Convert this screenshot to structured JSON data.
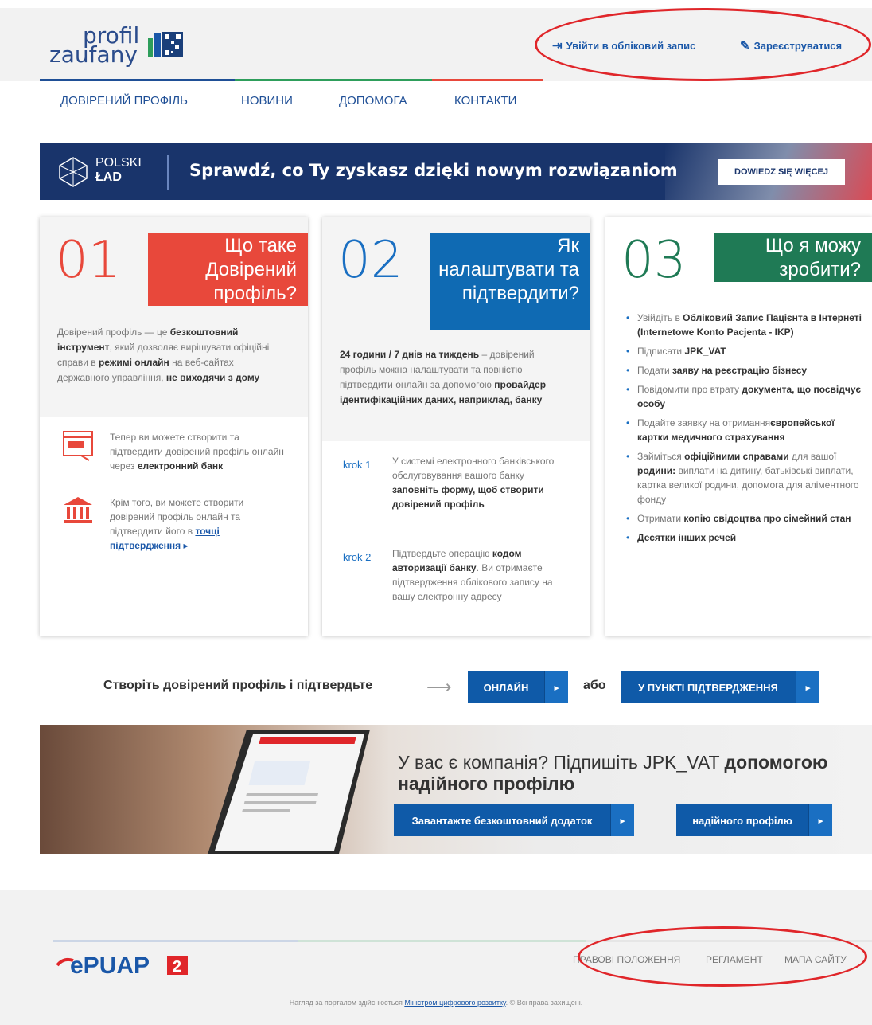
{
  "header": {
    "logo_line1": "profil",
    "logo_line2": "zaufany",
    "login": "Увійти в обліковий запис",
    "register": "Зареєструватися"
  },
  "colors": {
    "blue": "#1f4f96",
    "red": "#e8483b",
    "green": "#1f7a55",
    "navy": "#19346b"
  },
  "nav": [
    "ДОВІРЕНИЙ ПРОФІЛЬ",
    "НОВИНИ",
    "ДОПОМОГА",
    "КОНТАКТИ"
  ],
  "banner": {
    "logo_top": "POLSKI",
    "logo_bottom": "ŁAD",
    "text": "Sprawdź, co Ty zyskasz dzięki nowym rozwiązaniom",
    "button": "DOWIEDZ SIĘ WIĘCEJ"
  },
  "card1": {
    "num": "01",
    "title": "Що таке Довірений профіль?",
    "p": "Довірений профіль — це ",
    "p_b1": "безкоштовний інструмент",
    "p2": ", який дозволяє вирішувати офіційні справи в ",
    "p_b2": "режимі онлайн",
    "p3": " на веб-сайтах державного управління, ",
    "p_b3": "не виходячи з дому",
    "r1": "Тепер ви можете створити та підтвердити довірений профіль онлайн через ",
    "r1_b": "електронний банк",
    "r2": "Крім того, ви можете створити довірений профіль онлайн та підтвердити його в ",
    "r2_link": "точці підтвердження",
    "r2_arrow": "▸"
  },
  "card2": {
    "num": "02",
    "title": "Як налаштувати та підтвердити?",
    "p_b": "24 години / 7 днів на тиждень",
    "p": " – довірений профіль можна налаштувати та повністю підтвердити онлайн за допомогою ",
    "p_b2": "провайдер ідентифікаційних даних, наприклад, банку",
    "k1": "krok 1",
    "k1_t": "У системі електронного банківського обслуговування вашого банку ",
    "k1_b": "заповніть форму, щоб створити довірений профіль",
    "k2": "krok 2",
    "k2_t": "Підтвердьте операцію ",
    "k2_b": "кодом авторизації банку",
    "k2_t2": ". Ви отримаєте підтвердження облікового запису на вашу електронну адресу"
  },
  "card3": {
    "num": "03",
    "title": "Що я можу зробити?",
    "items": [
      {
        "t": "Увійдіть в ",
        "b": "Обліковий Запис Пацієнта в Інтернеті (Internetowe Konto Pacjenta - IKP)",
        "t2": ""
      },
      {
        "t": "Підписати ",
        "b": "JPK_VAT",
        "t2": ""
      },
      {
        "t": "Подати ",
        "b": "заяву на реєстрацію бізнесу",
        "t2": ""
      },
      {
        "t": "Повідомити про втрату ",
        "b": "документа, що посвідчує особу",
        "t2": ""
      },
      {
        "t": "Подайте заявку на отримання",
        "b": "європейської картки медичного страхування",
        "t2": ""
      },
      {
        "t": "Займіться ",
        "b": "офіційними справами",
        "t2": " для вашої ",
        "b2": "родини:",
        "t3": " виплати на дитину, батьківські виплати, картка великої родини, допомога для аліментного фонду"
      },
      {
        "t": "Отримати ",
        "b": "копію свідоцтва про сімейний стан",
        "t2": ""
      },
      {
        "t": "",
        "b": "Десятки інших речей",
        "t2": ""
      }
    ]
  },
  "cta": {
    "text": "Створіть довірений профіль і підтвердьте",
    "arrow": "⟶",
    "online": "ОНЛАЙН",
    "or": "або",
    "point": "У ПУНКТІ ПІДТВЕРДЖЕННЯ",
    "chev": "▸"
  },
  "promo": {
    "title_a": "У вас є компанія? Підпишіть JPK_VAT ",
    "title_b": "допомогою надійного профілю",
    "btn1": "Завантажте безкоштовний додаток",
    "btn2": "надійного профілю"
  },
  "footer": {
    "links": [
      "ПРАВОВІ ПОЛОЖЕННЯ",
      "РЕГЛАМЕНТ",
      "МАПА САЙТУ"
    ],
    "copy_a": "Нагляд за порталом здійснюється ",
    "copy_link": "Міністром цифрового розвитку",
    "copy_b": ". © Всі права захищені."
  }
}
